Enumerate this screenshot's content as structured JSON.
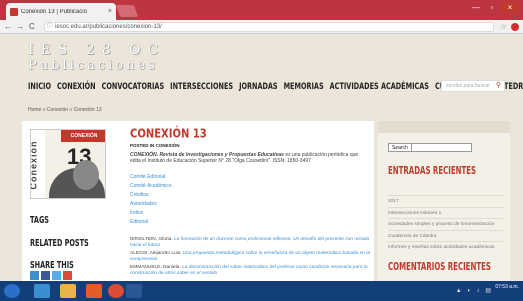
{
  "browser": {
    "tab_title": "Conexión 13 | Publicacio",
    "tab_close": "×",
    "url": "iesoc.edu.ar/publicaciones/conexion-13/",
    "back": "←",
    "forward": "→",
    "reload": "C",
    "info": "ⓘ",
    "star": "☆",
    "win_min": "—",
    "win_max": "▫",
    "win_close": "×"
  },
  "site": {
    "logo_line1": "IES 28 OC",
    "logo_line2": "Publicaciones",
    "nav": [
      "INICIO",
      "CONEXIÓN",
      "CONVOCATORIAS",
      "INTERSECCIONES",
      "JORNADAS",
      "MEMORIAS",
      "ACTIVIDADES ACADÉMICAS",
      "CUADERNOS DE CÁTEDRA"
    ],
    "search_placeholder": "escriba para buscar",
    "breadcrumb": "Home » Conexión » Conexión 13"
  },
  "cover": {
    "vertical_text": "Conexión",
    "red_label": "CONEXIÓN",
    "number": "13"
  },
  "post": {
    "title": "CONEXIÓN 13",
    "meta": "POSTED IN CONEXIÓN",
    "description_bold": "CONEXIÓN. Revista de Investigaciones y Propuestas Educativas",
    "description_rest": " es una publicación periódica que edita el Instituto de Educación Superior N° 28 \"Olga Cossettini\". ISSN: 1850-3497",
    "links": [
      "Comité Editorial",
      "Comité Académico",
      "Créditos",
      "Autoridades",
      "Índice",
      "Editorial"
    ],
    "refs": [
      {
        "author": "IERSILTEIN, Gloria. ",
        "title": "La formación de un docente como profesional reflexivo. Un desafío del presente con mirada hacia el futuro"
      },
      {
        "author": "ALEGSI, Alejandro Luis. ",
        "title": "Una propuesta metodológica sobre la enseñanza de un objeto matemático basada en la comprensión"
      },
      {
        "author": "EMMANUELE, Daniela. ",
        "title": "La deconstrucción del saber matemático del profesor como condición necesaria para la construcción de otros saber es el sentido"
      }
    ]
  },
  "left_headings": {
    "tags": "TAGS",
    "related": "RELATED POSTS",
    "share": "SHARE THIS"
  },
  "sidebar": {
    "search_button": "Search",
    "recent_title": "ENTRADAS RECIENTES",
    "recent_items": [
      "2017",
      "Intersecciones Número 1",
      "Sociedades simples y proceso de fenomenización",
      "Cuadernos de Cátedra",
      "Informes y reseñas sobre actividades académicas"
    ],
    "comments_title": "COMENTARIOS RECIENTES"
  },
  "taskbar": {
    "clock_time": "07:53 a.m.",
    "clock_date": "",
    "tray": "▲ ◐ ♪ ▤"
  },
  "colors": {
    "accent": "#c0392b",
    "link": "#3b8fd1",
    "page_bg": "#ebe6d9",
    "taskbar": "#123e7a"
  }
}
